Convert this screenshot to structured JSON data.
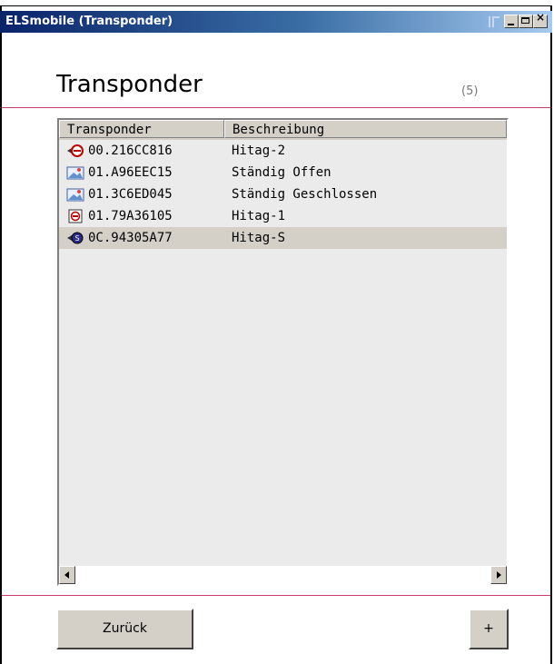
{
  "window": {
    "title": "ELSmobile (Transponder)"
  },
  "header": {
    "heading": "Transponder",
    "count": "(5)"
  },
  "list": {
    "columns": {
      "transponder": "Transponder",
      "beschreibung": "Beschreibung"
    },
    "rows": [
      {
        "id": "00.216CC816",
        "desc": "Hitag-2",
        "icon": "transponder-key-red-icon"
      },
      {
        "id": "01.A96EEC15",
        "desc": "Ständig Offen",
        "icon": "picture-icon"
      },
      {
        "id": "01.3C6ED045",
        "desc": "Ständig Geschlossen",
        "icon": "picture-icon"
      },
      {
        "id": "01.79A36105",
        "desc": "Hitag-1",
        "icon": "transponder-card-icon"
      },
      {
        "id": "0C.94305A77",
        "desc": "Hitag-S",
        "icon": "transponder-key-blue-icon",
        "selected": true
      }
    ]
  },
  "footer": {
    "back_label": "Zurück",
    "add_label": "+"
  },
  "colors": {
    "accent_line": "#c83c6e",
    "titlebar_start": "#0a246a",
    "list_bg": "#ebebeb",
    "selection": "#d4d0c8"
  }
}
